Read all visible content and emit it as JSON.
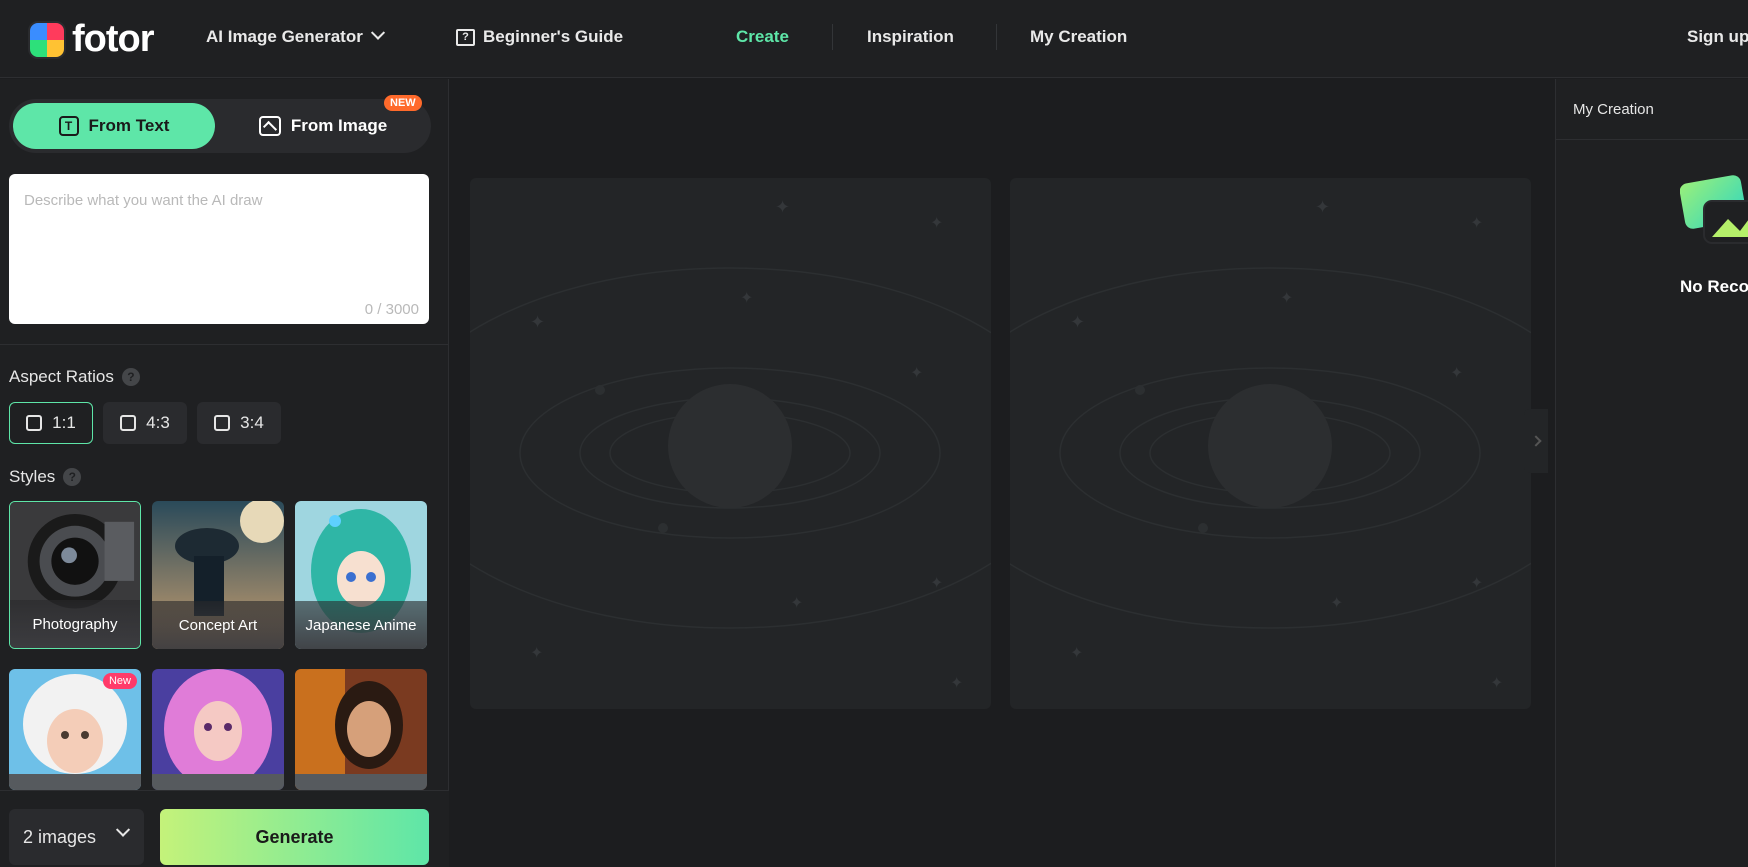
{
  "header": {
    "logo_text": "fotor",
    "nav": [
      {
        "label": "AI Image Generator"
      },
      {
        "label": "Beginner's Guide"
      },
      {
        "label": "Create"
      },
      {
        "label": "Inspiration"
      },
      {
        "label": "My Creation"
      }
    ],
    "signup_label": "Sign up"
  },
  "left": {
    "modes": {
      "from_text": "From Text",
      "from_image": "From Image",
      "new_badge": "NEW",
      "t_glyph": "T"
    },
    "prompt": {
      "placeholder": "Describe what you want the AI draw",
      "counter": "0 / 3000"
    },
    "aspect_title": "Aspect Ratios",
    "help_glyph": "?",
    "ratios": [
      "1:1",
      "4:3",
      "3:4"
    ],
    "styles_title": "Styles",
    "styles": [
      {
        "label": "Photography"
      },
      {
        "label": "Concept Art"
      },
      {
        "label": "Japanese Anime"
      },
      {
        "label": "",
        "badge": "New"
      },
      {
        "label": ""
      },
      {
        "label": ""
      }
    ],
    "image_count": "2 images",
    "generate_label": "Generate"
  },
  "right": {
    "title": "My Creation",
    "empty_text": "No Records"
  },
  "colors": {
    "accent": "#5ee6a8",
    "background": "#1c1d1f",
    "panel": "#1f2022",
    "badge_orange": "#ff6a2b",
    "badge_pink": "#ff3b6a"
  }
}
